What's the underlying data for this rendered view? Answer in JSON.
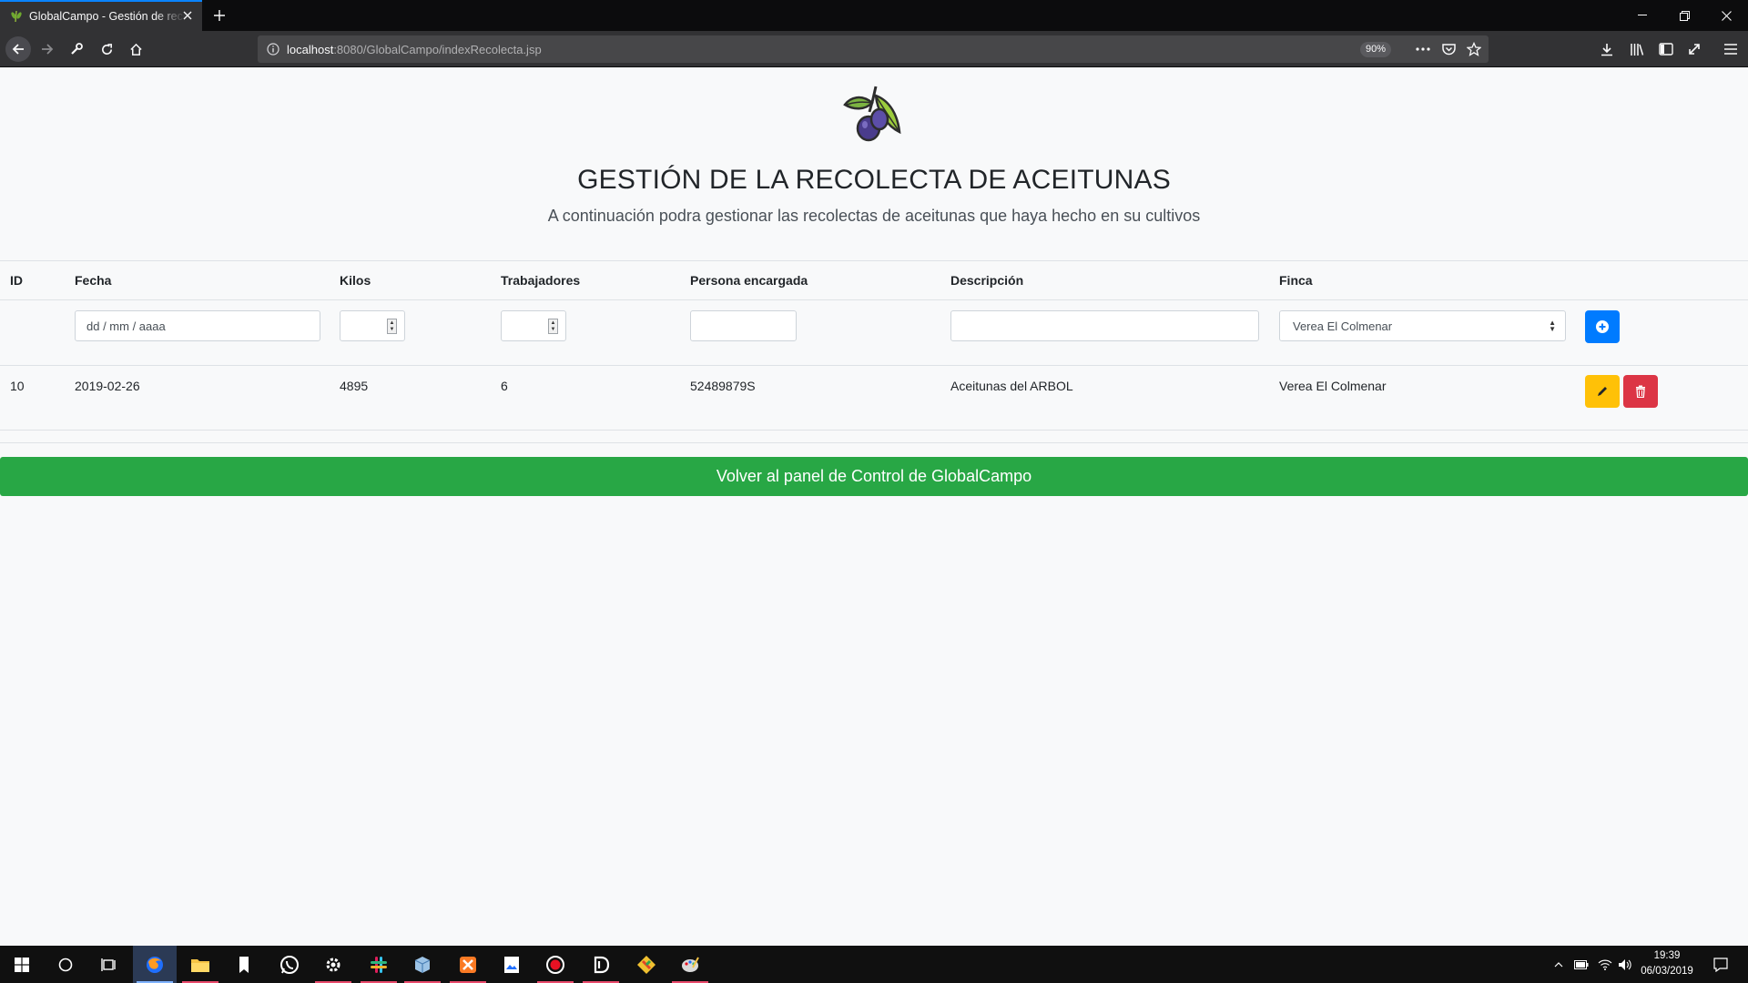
{
  "browser": {
    "tab_title": "GlobalCampo - Gestión de recolecta",
    "url_host": "localhost",
    "url_rest": ":8080/GlobalCampo/indexRecolecta.jsp",
    "zoom": "90%"
  },
  "page": {
    "title": "GESTIÓN DE LA RECOLECTA DE ACEITUNAS",
    "subtitle": "A continuación podra gestionar las recolectas de aceitunas que haya hecho en su cultivos"
  },
  "table": {
    "headers": [
      "ID",
      "Fecha",
      "Kilos",
      "Trabajadores",
      "Persona encargada",
      "Descripción",
      "Finca"
    ],
    "new_row": {
      "fecha_placeholder": "dd / mm / aaaa",
      "kilos": "",
      "trabajadores": "",
      "persona": "",
      "descripcion": "",
      "finca_selected": "Verea El Colmenar"
    },
    "rows": [
      {
        "id": "10",
        "fecha": "2019-02-26",
        "kilos": "4895",
        "trabajadores": "6",
        "persona": "52489879S",
        "descripcion": "Aceitunas del ARBOL",
        "finca": "Verea El Colmenar"
      }
    ]
  },
  "back_button_label": "Volver al panel de Control de GlobalCampo",
  "taskbar": {
    "time": "19:39",
    "date": "06/03/2019",
    "apps": [
      "windows-start-icon",
      "search-circle-icon",
      "task-view-icon",
      "firefox-icon",
      "file-explorer-icon",
      "bookmark-app-icon",
      "whatsapp-icon",
      "settings-icon",
      "slack-icon",
      "box-app-icon",
      "xampp-icon",
      "photos-icon",
      "record-icon",
      "dbeaver-icon",
      "git-icon",
      "paint-icon"
    ]
  },
  "colors": {
    "primary": "#007bff",
    "warning": "#ffc107",
    "danger": "#dc3545",
    "success": "#28a745"
  }
}
